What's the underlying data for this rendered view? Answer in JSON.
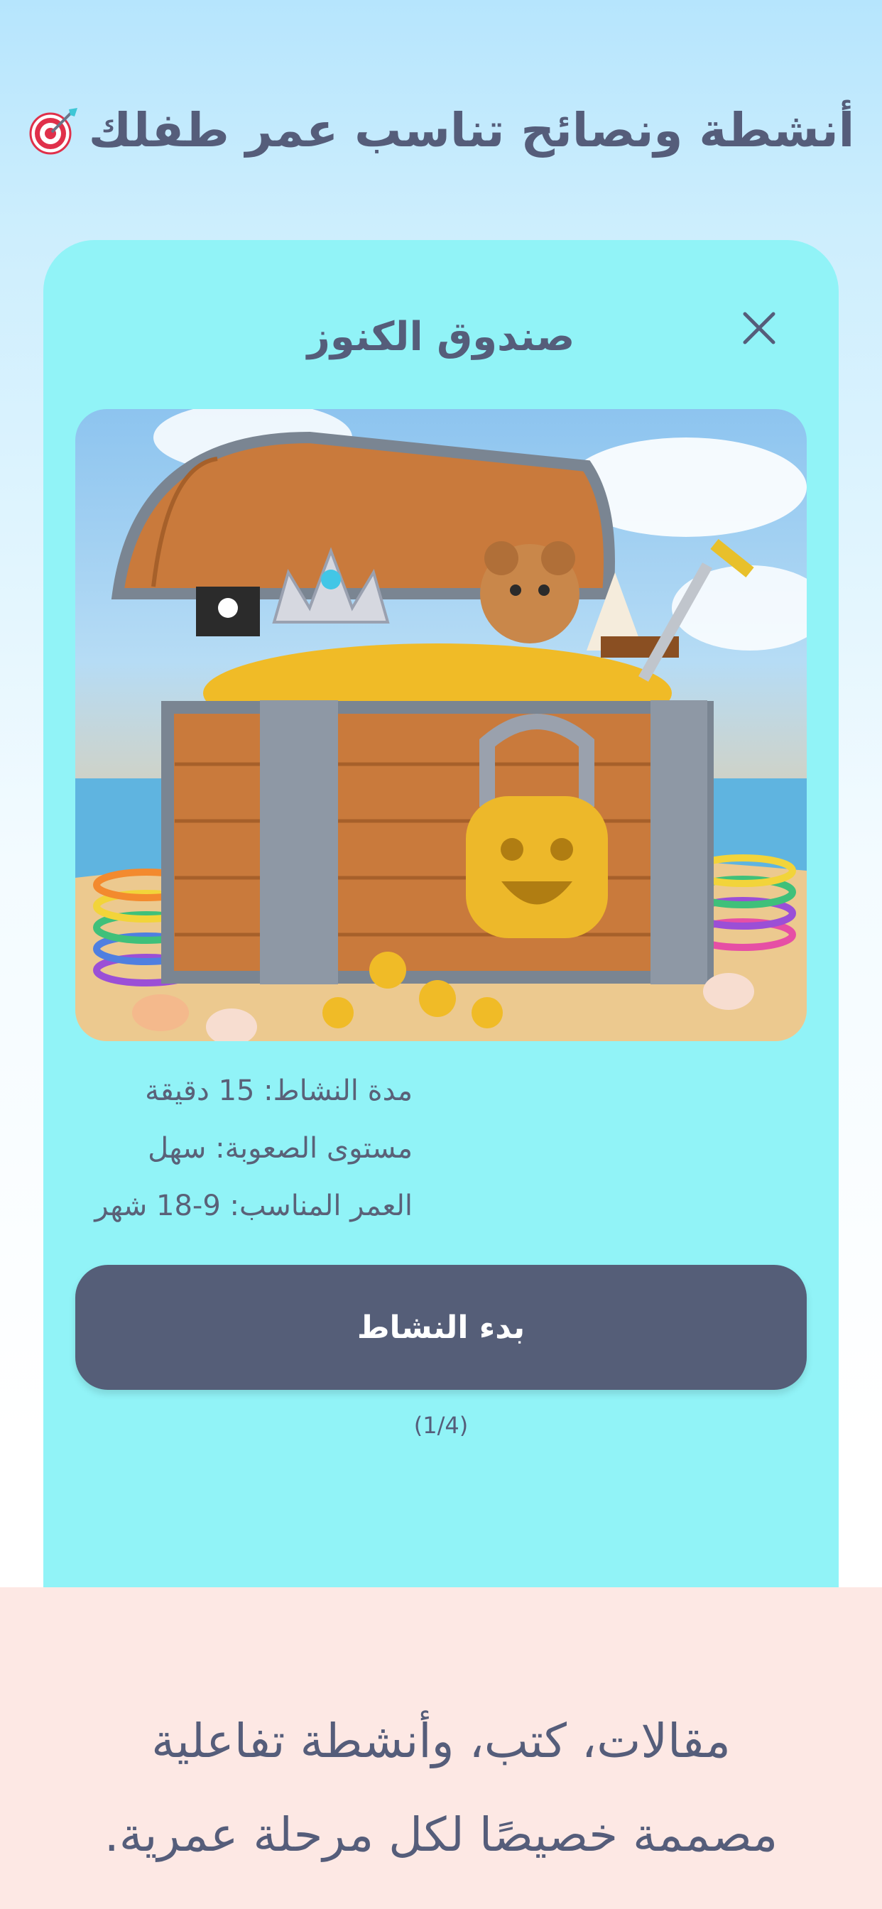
{
  "header": {
    "title": "أنشطة ونصائح تناسب عمر طفلك",
    "icon": "target-dart-icon"
  },
  "activity_card": {
    "title": "صندوق الكنوز",
    "close_icon": "close-icon",
    "image": "treasure-chest-illustration",
    "duration": "مدة النشاط: 15 دقيقة",
    "difficulty": "مستوى الصعوبة: سهل",
    "age": "العمر المناسب: 9-18 شهر",
    "start_label": "بدء النشاط",
    "pager": "(1/4)"
  },
  "footer": {
    "line1": "مقالات، كتب، وأنشطة تفاعلية",
    "line2": "مصممة خصيصًا لكل مرحلة عمرية."
  },
  "colors": {
    "card_bg": "#91f3f7",
    "button_bg": "#555e78",
    "text": "#555d7a",
    "footer_bg": "#fde8e4"
  }
}
